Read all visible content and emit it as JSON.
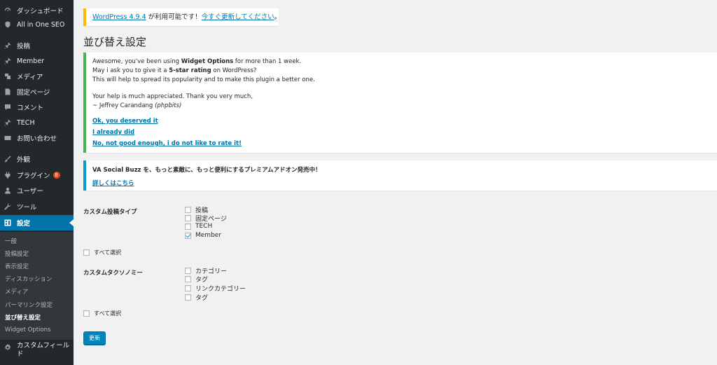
{
  "sidebar": {
    "items": [
      {
        "label": "ダッシュボード",
        "icon": "dashboard-icon"
      },
      {
        "label": "All in One SEO",
        "icon": "shield-icon"
      },
      {
        "label": "投稿",
        "icon": "pin-icon"
      },
      {
        "label": "Member",
        "icon": "pin-icon"
      },
      {
        "label": "メディア",
        "icon": "media-icon"
      },
      {
        "label": "固定ページ",
        "icon": "page-icon"
      },
      {
        "label": "コメント",
        "icon": "comment-icon"
      },
      {
        "label": "TECH",
        "icon": "pin-icon"
      },
      {
        "label": "お問い合わせ",
        "icon": "mail-icon"
      },
      {
        "label": "外観",
        "icon": "brush-icon"
      },
      {
        "label": "プラグイン",
        "icon": "plugin-icon",
        "badge": "8"
      },
      {
        "label": "ユーザー",
        "icon": "user-icon"
      },
      {
        "label": "ツール",
        "icon": "wrench-icon"
      },
      {
        "label": "設定",
        "icon": "settings-icon",
        "active": true
      },
      {
        "label": "カスタムフィールド",
        "icon": "gear-icon"
      }
    ],
    "submenu": [
      "一般",
      "投稿設定",
      "表示設定",
      "ディスカッション",
      "メディア",
      "パーマリンク設定",
      "並び替え設定",
      "Widget Options"
    ],
    "submenu_current": "並び替え設定",
    "accent_color": "#0073aa"
  },
  "update_nag": {
    "version_link": "WordPress 4.9.4",
    "middle_text": " が利用可能です！",
    "update_link": "今すぐ更新してください",
    "end_text": "。"
  },
  "page_title": "並び替え設定",
  "widget_notice": {
    "line1_pre": "Awesome, you've been using ",
    "line1_bold": "Widget Options",
    "line1_post": " for more than 1 week.",
    "line2_pre": "May i ask you to give it a ",
    "line2_bold": "5-star rating",
    "line2_post": " on WordPress?",
    "line3": "This will help to spread its popularity and to make this plugin a better one.",
    "line4": "Your help is much appreciated. Thank you very much,",
    "line5_pre": "~ Jeffrey Carandang ",
    "line5_italic": "(phpbits)",
    "link1": "Ok, you deserved it",
    "link2": "I already did",
    "link3": "No, not good enough, i do not like to rate it!"
  },
  "va_notice": {
    "text": "VA Social Buzz を、もっと素敵に、もっと便利にするプレミアムアドオン発売中！",
    "link": "詳しくはこちら"
  },
  "form": {
    "post_types_label": "カスタム投稿タイプ",
    "post_types": [
      {
        "label": "投稿",
        "checked": false
      },
      {
        "label": "固定ページ",
        "checked": false
      },
      {
        "label": "TECH",
        "checked": false
      },
      {
        "label": "Member",
        "checked": true
      }
    ],
    "select_all_1": "すべて選択",
    "taxonomies_label": "カスタムタクソノミー",
    "taxonomies": [
      {
        "label": "カテゴリー",
        "checked": false
      },
      {
        "label": "タグ",
        "checked": false
      },
      {
        "label": "リンクカテゴリー",
        "checked": false
      },
      {
        "label": "タグ",
        "checked": false
      }
    ],
    "select_all_2": "すべて選択",
    "submit_label": "更新"
  }
}
